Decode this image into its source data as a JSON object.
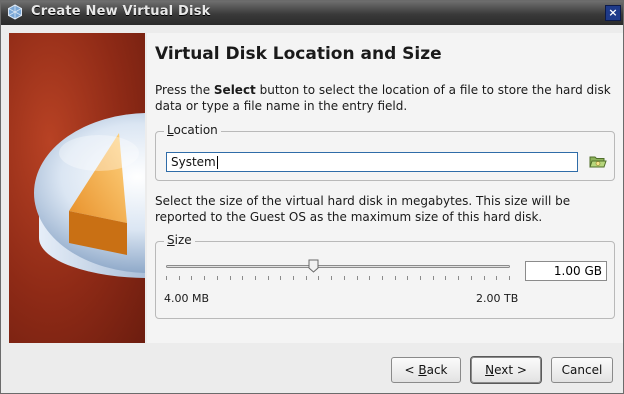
{
  "window": {
    "title": "Create New Virtual Disk",
    "close_glyph": "×"
  },
  "page": {
    "heading": "Virtual Disk Location and Size",
    "location_desc": {
      "prefix": "Press the ",
      "bold": "Select",
      "suffix": " button to select the location of a file to store the hard disk data or type a file name in the entry field."
    },
    "location": {
      "legend_mnemonic": "L",
      "legend_rest": "ocation",
      "value": "System",
      "select_button_icon": "folder-open-icon"
    },
    "size_desc": "Select the size of the virtual hard disk in megabytes. This size will be reported to the Guest OS as the maximum size of this hard disk.",
    "size": {
      "legend_mnemonic": "S",
      "legend_rest": "ize",
      "slider_fraction": 0.43,
      "min_label": "4.00 MB",
      "max_label": "2.00 TB",
      "value": "1.00 GB"
    }
  },
  "buttons": {
    "back_prefix": "< ",
    "back_mnemonic": "B",
    "back_rest": "ack",
    "next_mnemonic": "N",
    "next_rest": "ext >",
    "cancel": "Cancel"
  },
  "colors": {
    "banner": "#8e2a16",
    "focus_border": "#2f6ca8"
  }
}
